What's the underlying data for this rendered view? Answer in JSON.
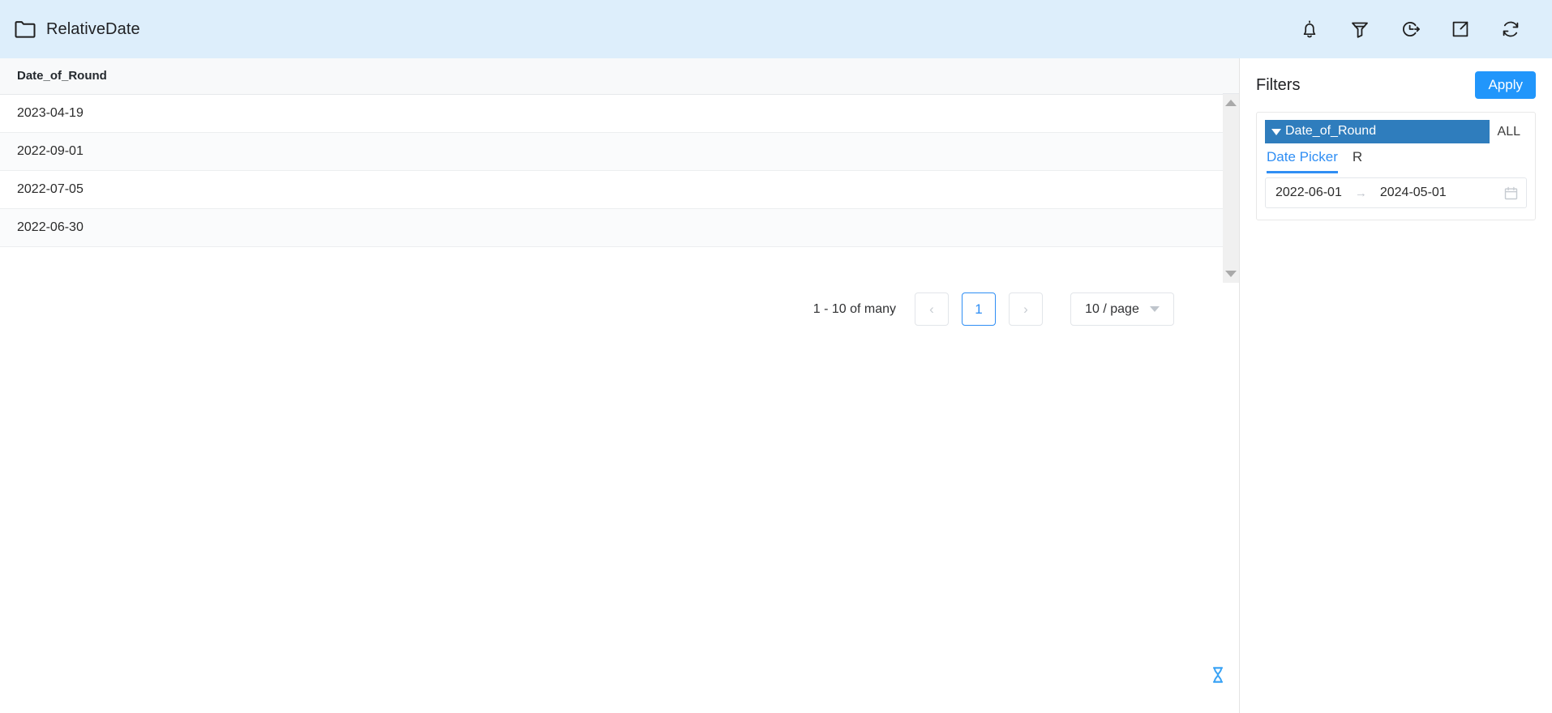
{
  "header": {
    "title": "RelativeDate",
    "folder_icon": "folder-icon",
    "actions": [
      {
        "name": "notifications-icon",
        "label": "Notifications"
      },
      {
        "name": "filter-funnel-icon",
        "label": "Filter"
      },
      {
        "name": "history-clock-icon",
        "label": "History"
      },
      {
        "name": "export-icon",
        "label": "Export"
      },
      {
        "name": "refresh-icon",
        "label": "Refresh"
      }
    ],
    "bg_color": "#ddeefb"
  },
  "table": {
    "columns": [
      "Date_of_Round"
    ],
    "rows": [
      [
        "2023-04-19"
      ],
      [
        "2022-09-01"
      ],
      [
        "2022-07-05"
      ],
      [
        "2022-06-30"
      ]
    ]
  },
  "pagination": {
    "summary": "1 - 10 of many",
    "prev_label": "‹",
    "next_label": "›",
    "current_page": "1",
    "page_size": "10 / page"
  },
  "status": {
    "loading_icon": "hourglass-icon"
  },
  "filters": {
    "title": "Filters",
    "apply_label": "Apply",
    "apply_color": "#2196fb",
    "chip_color": "#2f7dbd",
    "accent_color": "#2f8ef4",
    "field": {
      "name": "Date_of_Round",
      "scope_label": "ALL",
      "tabs": [
        {
          "label": "Date Picker",
          "active": true
        },
        {
          "label": "R",
          "active": false
        }
      ],
      "date_range": {
        "start": "2022-06-01",
        "end": "2024-05-01",
        "separator": "→",
        "calendar_icon": "calendar-icon"
      }
    }
  }
}
